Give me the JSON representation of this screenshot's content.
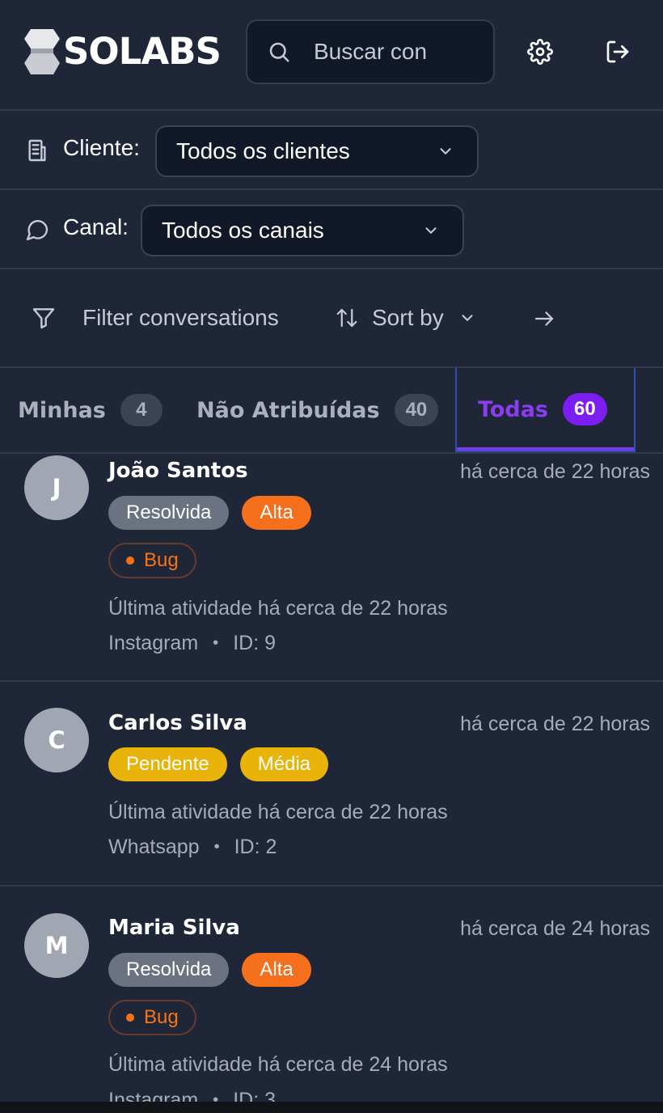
{
  "header": {
    "logo_text": "SOLABS",
    "search_placeholder": "Buscar con",
    "settings_icon": "gear-icon",
    "logout_icon": "logout-icon"
  },
  "filters": {
    "client": {
      "label": "Cliente:",
      "value": "Todos os clientes"
    },
    "channel": {
      "label": "Canal:",
      "value": "Todos os canais"
    }
  },
  "toolbar": {
    "filter_label": "Filter conversations",
    "sort_label": "Sort by"
  },
  "tabs": [
    {
      "label": "Minhas",
      "count": "4",
      "active": false
    },
    {
      "label": "Não Atribuídas",
      "count": "40",
      "active": false
    },
    {
      "label": "Todas",
      "count": "60",
      "active": true
    }
  ],
  "conversations": [
    {
      "initial": "J",
      "name": "João Santos",
      "time": "há cerca de 22 horas",
      "status": "Resolvida",
      "priority": "Alta",
      "tag": "Bug",
      "activity": "Última atividade há cerca de 22 horas",
      "channel": "Instagram",
      "id": "ID: 9"
    },
    {
      "initial": "C",
      "name": "Carlos Silva",
      "time": "há cerca de 22 horas",
      "status": "Pendente",
      "priority": "Média",
      "activity": "Última atividade há cerca de 22 horas",
      "channel": "Whatsapp",
      "id": "ID: 2"
    },
    {
      "initial": "M",
      "name": "Maria Silva",
      "time": "há cerca de 24 horas",
      "status": "Resolvida",
      "priority": "Alta",
      "tag": "Bug",
      "activity": "Última atividade há cerca de 24 horas",
      "channel": "Instagram",
      "id": "ID: 3"
    }
  ],
  "colors": {
    "background": "#1e2637",
    "accent_purple": "#7b1ff0",
    "status_resolvida": "#6b7280",
    "priority_alta": "#f56f1c",
    "status_pendente": "#e9b309",
    "tag_bug": "#f97316"
  }
}
